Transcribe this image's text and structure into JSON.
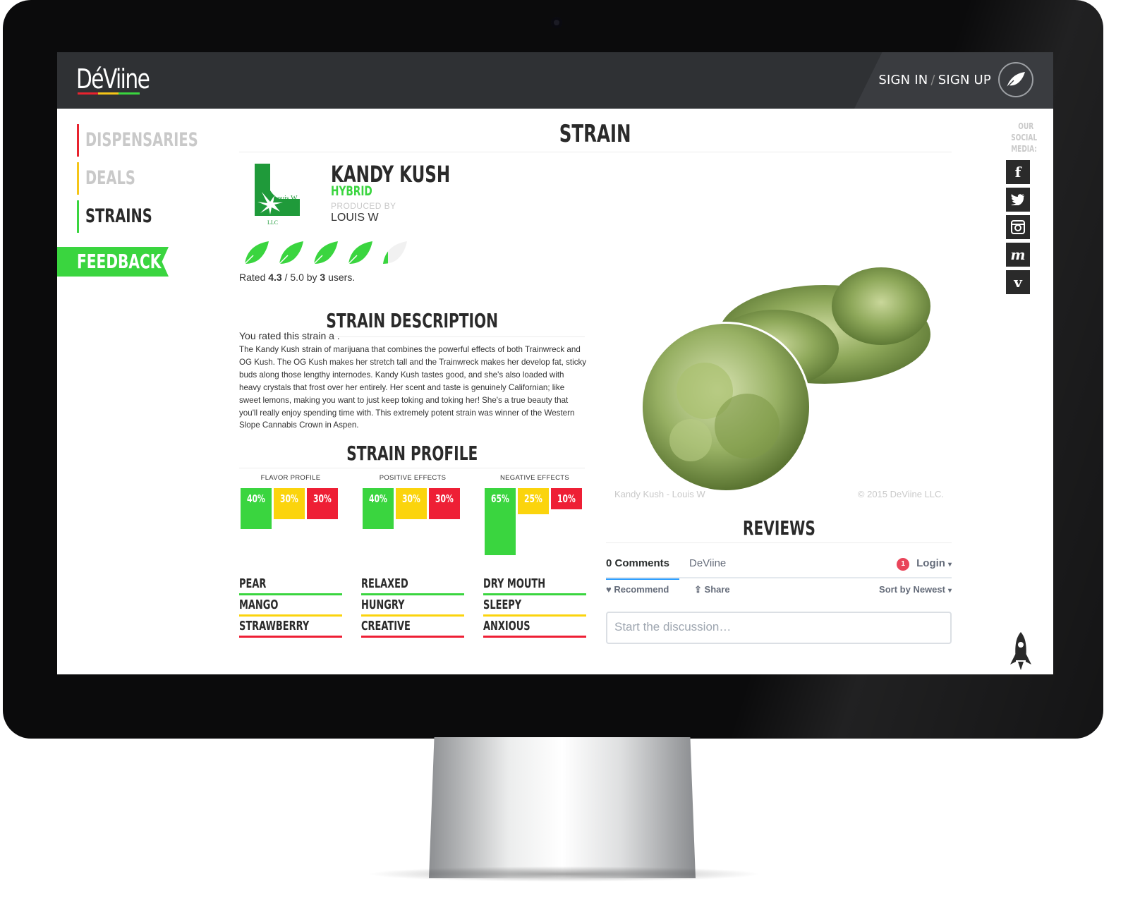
{
  "header": {
    "logo": "DéViine",
    "sign_in": "SIGN IN",
    "separator": "/",
    "sign_up": "SIGN UP",
    "account_icon": "leaf-icon"
  },
  "nav": {
    "items": [
      {
        "label": "DISPENSARIES",
        "color": "#e8232e"
      },
      {
        "label": "DEALS",
        "color": "#f5c518"
      },
      {
        "label": "STRAINS",
        "color": "#3ad53f",
        "active": true
      }
    ],
    "feedback": "FEEDBACK"
  },
  "page": {
    "title": "STRAIN"
  },
  "strain": {
    "name": "KANDY KUSH",
    "type": "HYBRID",
    "produced_by_label": "PRODUCED BY",
    "producer": "LOUIS W",
    "logo_text_top": "Louis W.",
    "logo_text_bottom": "LLC",
    "rating": {
      "value": 4.3,
      "max": 5.0,
      "users": 3,
      "prefix": "Rated",
      "value_text": "4.3",
      "mid": "/ 5.0 by",
      "users_text": "3",
      "suffix": "users."
    }
  },
  "description": {
    "title": "STRAIN DESCRIPTION",
    "you_rated": "You rated this strain a .",
    "body": "The Kandy Kush strain of marijuana that combines the powerful effects of both Trainwreck and OG Kush. The OG Kush makes her stretch tall and the Trainwreck makes her develop fat, sticky buds along those lengthy internodes. Kandy Kush tastes good, and she's also loaded with heavy crystals that frost over her entirely. Her scent and taste is genuinely Californian; like sweet lemons, making you want to just keep toking and toking her! She's a true beauty that you'll really enjoy spending time with. This extremely potent strain was winner of the Western Slope Cannabis Crown in Aspen."
  },
  "profile": {
    "title": "STRAIN PROFILE",
    "columns": [
      {
        "title": "FLAVOR PROFILE",
        "bars": [
          {
            "value": 40,
            "label": "40%"
          },
          {
            "value": 30,
            "label": "30%"
          },
          {
            "value": 30,
            "label": "30%"
          }
        ],
        "tags": [
          "PEAR",
          "MANGO",
          "STRAWBERRY"
        ]
      },
      {
        "title": "POSITIVE EFFECTS",
        "bars": [
          {
            "value": 40,
            "label": "40%"
          },
          {
            "value": 30,
            "label": "30%"
          },
          {
            "value": 30,
            "label": "30%"
          }
        ],
        "tags": [
          "RELAXED",
          "HUNGRY",
          "CREATIVE"
        ]
      },
      {
        "title": "NEGATIVE EFFECTS",
        "bars": [
          {
            "value": 65,
            "label": "65%"
          },
          {
            "value": 25,
            "label": "25%"
          },
          {
            "value": 10,
            "label": "10%"
          }
        ],
        "tags": [
          "DRY MOUTH",
          "SLEEPY",
          "ANXIOUS"
        ]
      }
    ]
  },
  "image": {
    "caption_left": "Kandy Kush - Louis W",
    "caption_right": "© 2015 DeViine LLC."
  },
  "reviews": {
    "title": "REVIEWS",
    "comments_tab": "0 Comments",
    "brand_tab": "DeViine",
    "notification_count": "1",
    "login": "Login",
    "recommend": "Recommend",
    "share": "Share",
    "sort": "Sort by Newest",
    "placeholder": "Start the discussion…"
  },
  "social": {
    "label_lines": [
      "OUR",
      "SOCIAL",
      "MEDIA:"
    ],
    "items": [
      {
        "icon": "facebook-icon",
        "glyph": "f"
      },
      {
        "icon": "twitter-icon",
        "glyph": ""
      },
      {
        "icon": "instagram-icon",
        "glyph": ""
      },
      {
        "icon": "medium-icon",
        "glyph": "m"
      },
      {
        "icon": "vine-icon",
        "glyph": "v"
      }
    ]
  },
  "colors": {
    "green": "#3ad53f",
    "yellow": "#fbd40d",
    "red": "#ee1f35",
    "topbar": "#2f3134"
  }
}
